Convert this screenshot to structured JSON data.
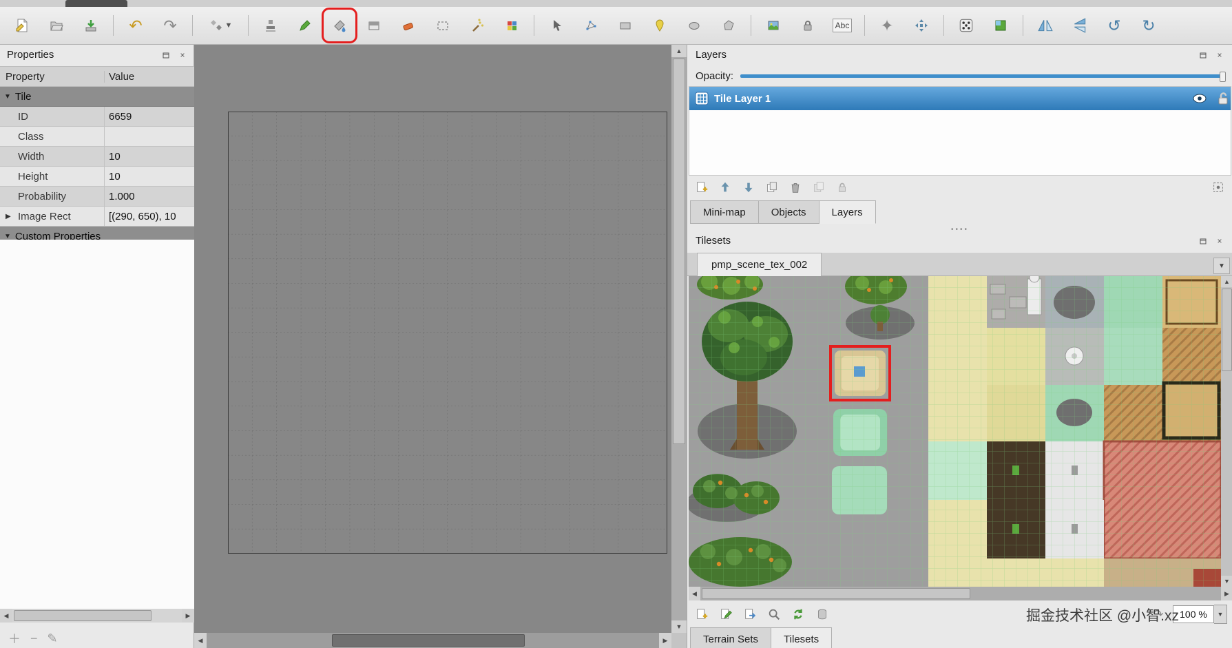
{
  "colors": {
    "accent": "#3f8ecb",
    "selection_red": "#e41e1e"
  },
  "toolbar": {
    "text_tool_label": "Abc",
    "highlighted_tool": "bucket-fill",
    "icons": [
      "new-file",
      "open-file",
      "save-file",
      "undo",
      "redo",
      "random-stamp",
      "stamp-brush",
      "terrain-brush",
      "bucket-fill",
      "shape-fill",
      "eraser",
      "rectangular-select",
      "magic-wand",
      "select-same-tile",
      "select-object",
      "edit-polygons",
      "insert-rectangle",
      "insert-point",
      "insert-ellipse",
      "insert-polygon",
      "insert-tile",
      "insert-template",
      "insert-text",
      "sparkle",
      "pan",
      "die",
      "tileset-view",
      "flip-horizontal",
      "flip-vertical",
      "rotate-left",
      "rotate-right"
    ]
  },
  "properties_panel": {
    "title": "Properties",
    "columns": [
      "Property",
      "Value"
    ],
    "groups": [
      {
        "label": "Tile",
        "rows": [
          {
            "label": "ID",
            "value": "6659"
          },
          {
            "label": "Class",
            "value": ""
          },
          {
            "label": "Width",
            "value": "10"
          },
          {
            "label": "Height",
            "value": "10"
          },
          {
            "label": "Probability",
            "value": "1.000"
          },
          {
            "label": "Image Rect",
            "value": "[(290, 650), 10"
          }
        ]
      },
      {
        "label": "Custom Properties",
        "rows": []
      }
    ]
  },
  "map_view": {
    "grid_cols": 18,
    "grid_rows": 18
  },
  "layers_panel": {
    "title": "Layers",
    "opacity_label": "Opacity:",
    "layer": {
      "name": "Tile Layer 1",
      "selected": true,
      "visible": true
    },
    "tabs": [
      "Mini-map",
      "Objects",
      "Layers"
    ],
    "active_tab": "Layers"
  },
  "tilesets_panel": {
    "title": "Tilesets",
    "active_tileset_tab": "pmp_scene_tex_002",
    "zoom": "100 %",
    "bottom_tabs": [
      "Terrain Sets",
      "Tilesets"
    ],
    "active_bottom_tab": "Tilesets"
  },
  "watermark": "掘金技术社区 @小智.xz"
}
